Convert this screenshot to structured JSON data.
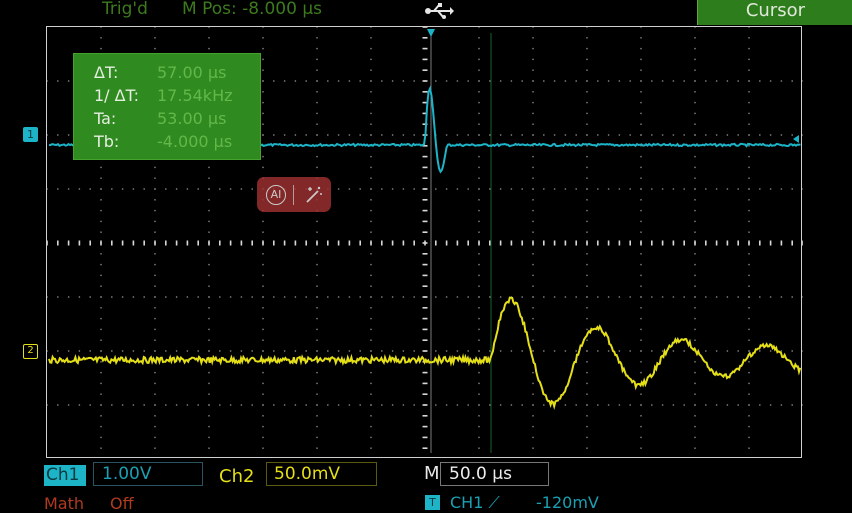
{
  "header": {
    "trigger_status": "Trig'd",
    "mpos_label": "M Pos:",
    "mpos_value": "-8.000 µs",
    "usb_icon": "usb-icon",
    "cursor_menu": "Cursor"
  },
  "measurements": {
    "rows": [
      {
        "key": "ΔT:",
        "value": "57.00 µs"
      },
      {
        "key": "1/ ΔT:",
        "value": "17.54kHz"
      },
      {
        "key": "Ta:",
        "value": "53.00 µs"
      },
      {
        "key": "Tb:",
        "value": "-4.000 µs"
      }
    ]
  },
  "overlay": {
    "ai_label": "AI",
    "icons": [
      "ai-circle-icon",
      "magic-wand-icon"
    ]
  },
  "channels": {
    "ch1_marker": "1",
    "ch2_marker": "2"
  },
  "footer": {
    "ch1_label": "Ch1",
    "ch1_scale": "1.00V",
    "ch2_label": "Ch2",
    "ch2_scale": "50.0mV",
    "timebase_label": "M",
    "timebase_value": "50.0 µs",
    "math_label": "Math",
    "off_label": "Off",
    "trigger_marker": "T",
    "trigger_source": "CH1 ⟋",
    "trigger_level": "-120mV"
  },
  "colors": {
    "ch1": "#1db4c8",
    "ch2": "#e5df18",
    "panel_green": "#2f8a1f",
    "grid": "#cfcfcf"
  }
}
